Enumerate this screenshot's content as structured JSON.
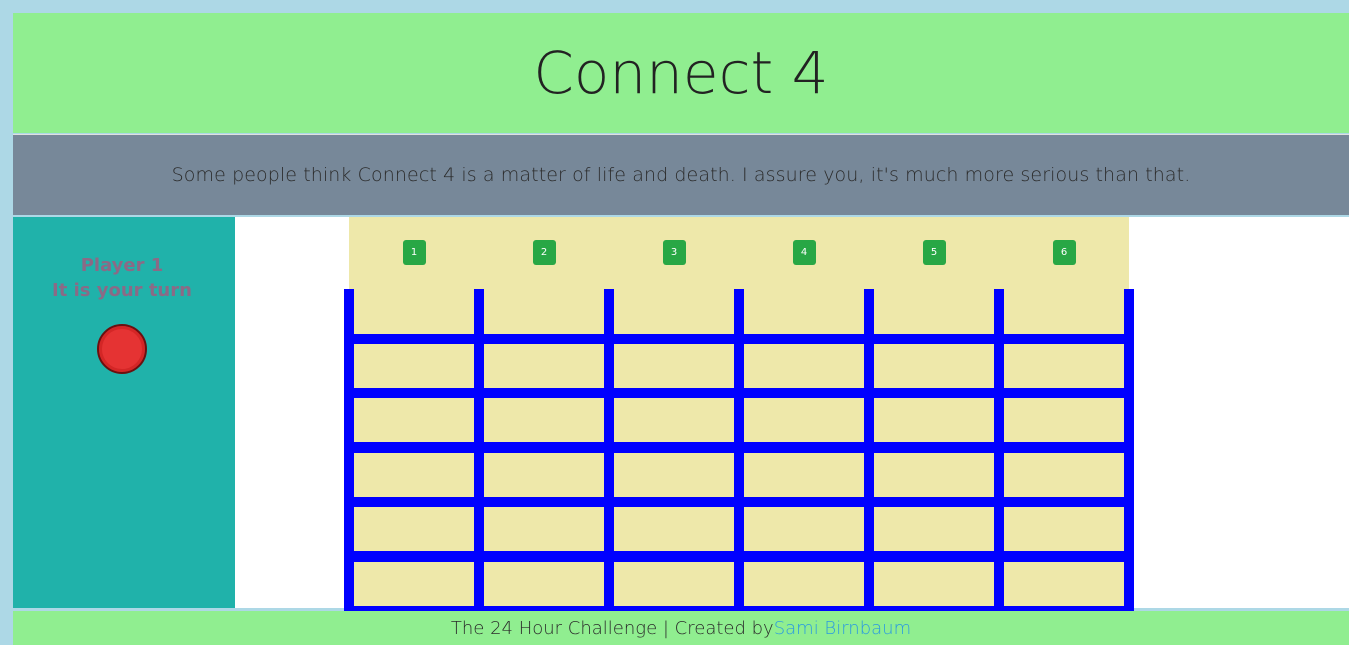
{
  "header": {
    "title": "Connect 4"
  },
  "quote": {
    "text": "Some people think Connect 4 is a matter of life and death. I assure you, it's much more serious than that."
  },
  "player_panel": {
    "player_name": "Player 1",
    "status": "It is your turn",
    "chip_color": "#e53333"
  },
  "board": {
    "columns": [
      {
        "label": "1"
      },
      {
        "label": "2"
      },
      {
        "label": "3"
      },
      {
        "label": "4"
      },
      {
        "label": "5"
      },
      {
        "label": "6"
      }
    ],
    "column_count": 6,
    "row_count": 6,
    "cells": [
      [
        "",
        "",
        "",
        "",
        "",
        ""
      ],
      [
        "",
        "",
        "",
        "",
        "",
        ""
      ],
      [
        "",
        "",
        "",
        "",
        "",
        ""
      ],
      [
        "",
        "",
        "",
        "",
        "",
        ""
      ],
      [
        "",
        "",
        "",
        "",
        "",
        ""
      ],
      [
        "",
        "",
        "",
        "",
        "",
        ""
      ]
    ],
    "grid_color": "#0000ff",
    "cell_color": "#eee8aa",
    "button_color": "#28a745"
  },
  "footer": {
    "prefix": "The 24 Hour Challenge | Created by ",
    "author_link": "Sami Birnbaum"
  }
}
